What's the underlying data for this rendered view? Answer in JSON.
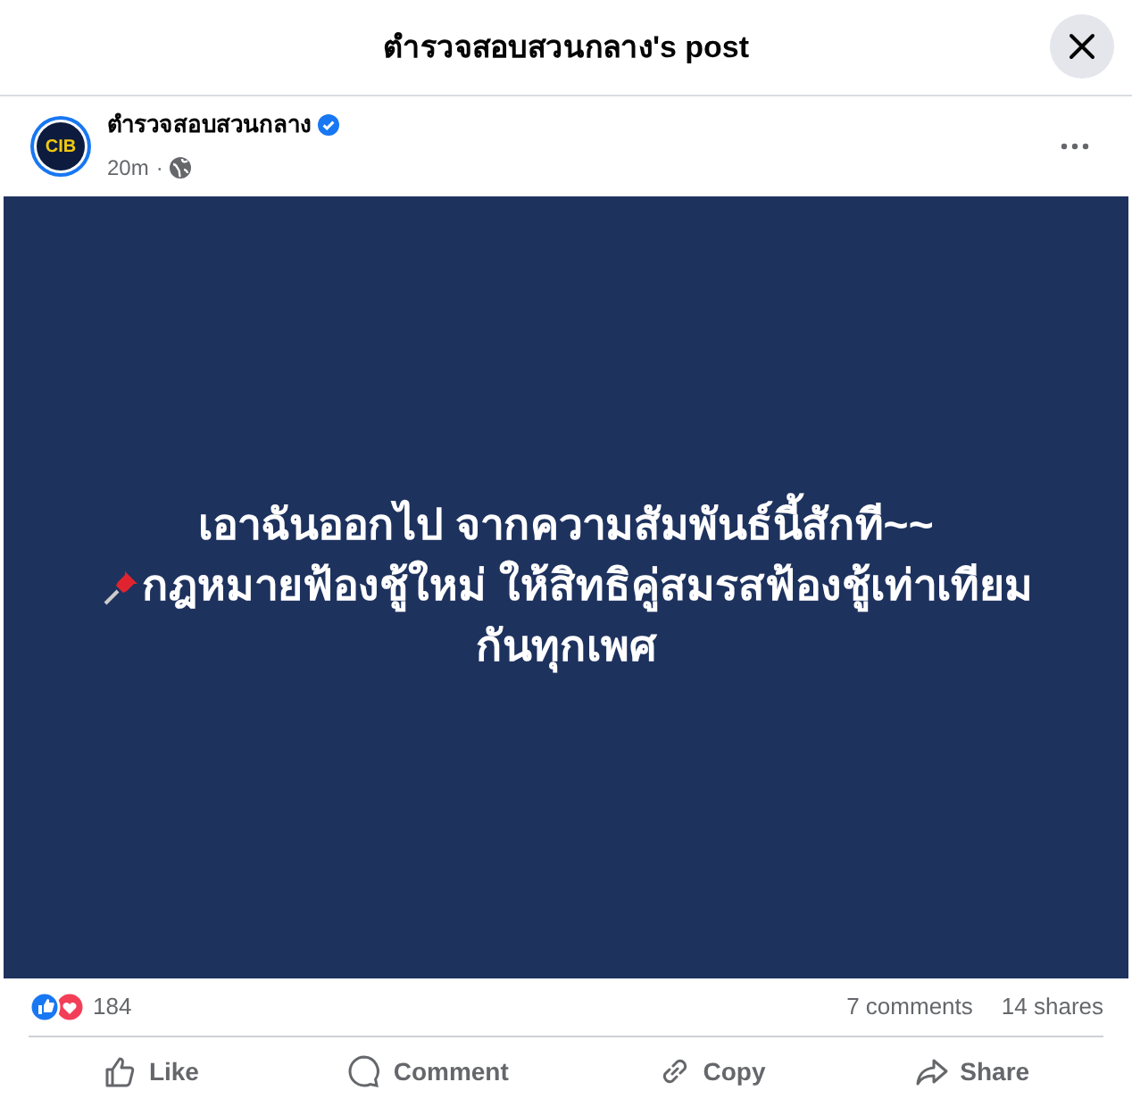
{
  "dialog": {
    "title": "ตำรวจสอบสวนกลาง's post"
  },
  "post": {
    "author": "ตำรวจสอบสวนกลาง",
    "verified": true,
    "avatar_text": "CIB",
    "time": "20m",
    "separator": "·",
    "lines": [
      {
        "text": "เอาฉันออกไป จากความสัมพันธ์นี้สักที~~",
        "pin": false
      },
      {
        "text": "กฎหมายฟ้องชู้ใหม่ ให้สิทธิคู่สมรสฟ้องชู้เท่าเทียม",
        "pin": true
      },
      {
        "text": "กันทุกเพศ",
        "pin": false
      }
    ]
  },
  "stats": {
    "reactions": "184",
    "comments": "7 comments",
    "shares": "14 shares"
  },
  "actions": [
    {
      "kind": "like",
      "label": "Like"
    },
    {
      "kind": "comment",
      "label": "Comment"
    },
    {
      "kind": "copy",
      "label": "Copy"
    },
    {
      "kind": "share",
      "label": "Share"
    }
  ]
}
